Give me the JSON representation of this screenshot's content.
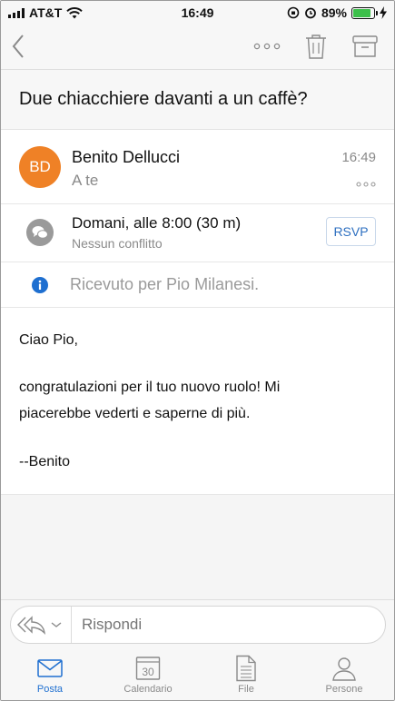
{
  "status_bar": {
    "carrier": "AT&T",
    "time": "16:49",
    "battery_percent": "89%",
    "battery_level": 0.89
  },
  "nav": {
    "back_icon": "chevron-left-icon",
    "more_icon": "ellipsis-icon",
    "delete_icon": "trash-icon",
    "archive_icon": "archive-icon"
  },
  "message": {
    "subject": "Due chiacchiere davanti a un caffè?",
    "sender": {
      "initials": "BD",
      "name": "Benito Dellucci",
      "recipient": "A te",
      "time": "16:49"
    },
    "meeting": {
      "title": "Domani, alle 8:00 (30 m)",
      "conflict": "Nessun conflitto",
      "rsvp_label": "RSVP"
    },
    "info": "Ricevuto per Pio Milanesi.",
    "body": {
      "greeting": "Ciao Pio,",
      "line1": "congratulazioni per il tuo nuovo ruolo! Mi",
      "line2": "piacerebbe vederti e saperne di più.",
      "signature": "--Benito"
    }
  },
  "reply": {
    "placeholder": "Rispondi"
  },
  "tabs": [
    {
      "label": "Posta",
      "icon": "mail-icon",
      "active": true
    },
    {
      "label": "Calendario",
      "icon": "calendar-icon",
      "active": false,
      "day": "30"
    },
    {
      "label": "File",
      "icon": "file-icon",
      "active": false
    },
    {
      "label": "Persone",
      "icon": "person-icon",
      "active": false
    }
  ],
  "colors": {
    "accent": "#1e6fd0",
    "avatar": "#ef8126",
    "battery": "#3cc04a"
  }
}
